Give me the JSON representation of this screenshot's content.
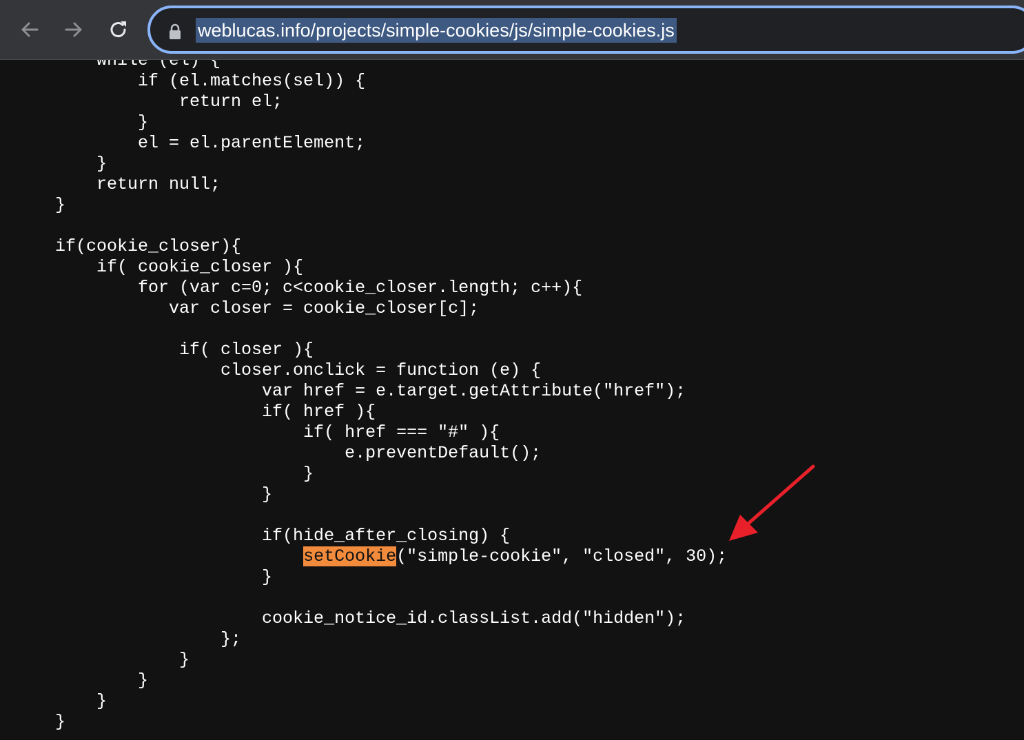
{
  "browser": {
    "url": "weblucas.info/projects/simple-cookies/js/simple-cookies.js",
    "icons": {
      "back": "arrow-left-icon",
      "forward": "arrow-right-icon",
      "reload": "reload-icon",
      "lock": "lock-icon"
    },
    "accent_color": "#8ab4f8"
  },
  "code": {
    "lines": [
      "    while (el) {",
      "        if (el.matches(sel)) {",
      "            return el;",
      "        }",
      "        el = el.parentElement;",
      "    }",
      "    return null;",
      "}",
      "",
      "if(cookie_closer){",
      "    if( cookie_closer ){",
      "        for (var c=0; c<cookie_closer.length; c++){",
      "           var closer = cookie_closer[c];",
      "",
      "            if( closer ){",
      "                closer.onclick = function (e) {",
      "                    var href = e.target.getAttribute(\"href\");",
      "                    if( href ){",
      "                        if( href === \"#\" ){",
      "                            e.preventDefault();",
      "                        }",
      "                    }",
      "",
      "                    if(hide_after_closing) {",
      "                        setCookie(\"simple-cookie\", \"closed\", 30);",
      "                    }",
      "",
      "                    cookie_notice_id.classList.add(\"hidden\");",
      "                };",
      "            }",
      "        }",
      "    }",
      "}"
    ],
    "highlight": {
      "prefix": "                        ",
      "term": "setCookie",
      "suffix": "(\"simple-cookie\", \"closed\", 30);",
      "color": "#f28b3c"
    }
  },
  "annotation": {
    "arrow_color": "#e8202a"
  }
}
